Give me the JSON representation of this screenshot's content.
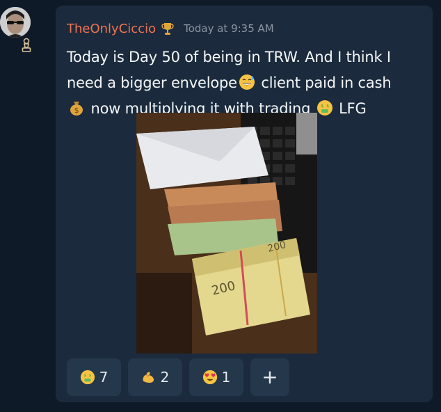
{
  "message": {
    "username": "TheOnlyCiccio",
    "timestamp": "Today at 9:35 AM",
    "text_parts": {
      "line1": "Today is Day 50 of being in TRW. And I think I",
      "line2_a": "need a bigger envelope",
      "line2_b": " client paid in cash",
      "line3_a": " now multiplying it with trading ",
      "line3_b": " LFG"
    },
    "image_alt": "Stacks of euro banknotes in an envelope next to a keyboard",
    "icons": {
      "avatar": "avatar-sunglasses",
      "rank": "chess-pawn-icon",
      "badge": "trophy-icon",
      "emoji_1": "sweat-smile-emoji",
      "emoji_2": "money-bag-emoji",
      "emoji_3": "money-mouth-emoji"
    }
  },
  "reactions": [
    {
      "emoji": "money-mouth-emoji",
      "count": "7"
    },
    {
      "emoji": "flexed-biceps-emoji",
      "count": "2"
    },
    {
      "emoji": "heart-eyes-emoji",
      "count": "1"
    }
  ],
  "add_reaction": "+",
  "colors": {
    "background": "#0f1a29",
    "card": "#1b2b3d",
    "username": "#f0734f",
    "timestamp": "#8b95a3",
    "text": "#f4f6f8",
    "reaction_bg": "#25374b"
  }
}
